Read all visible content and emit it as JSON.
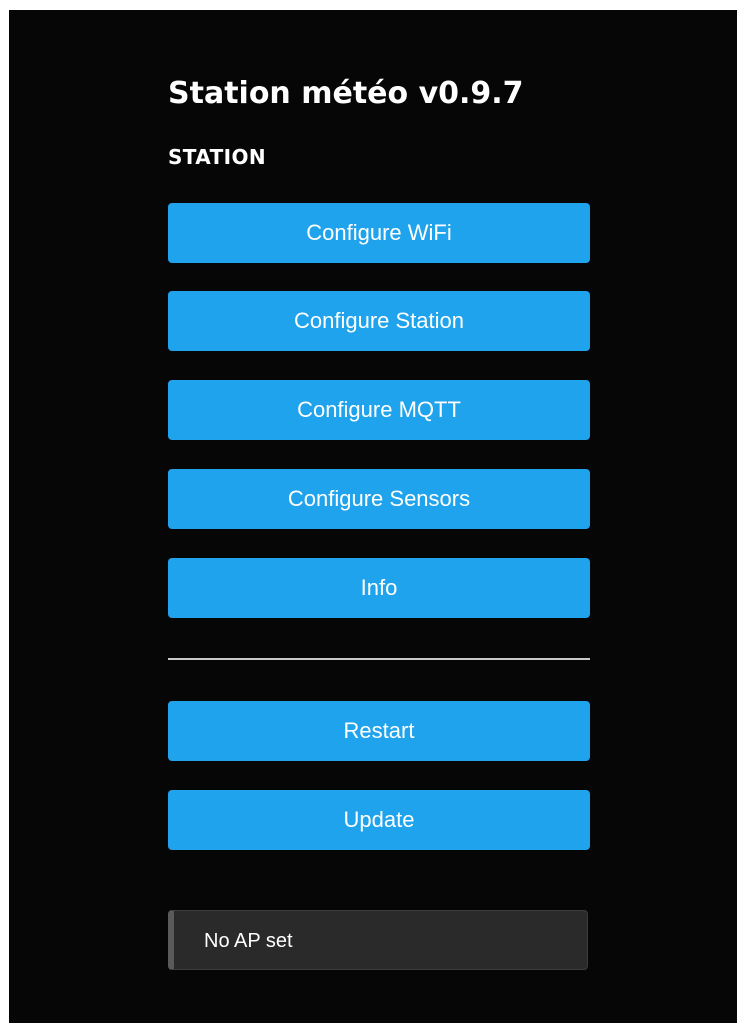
{
  "page": {
    "title": "Station météo v0.9.7",
    "section_label": "STATION"
  },
  "menu": {
    "configure_wifi": "Configure WiFi",
    "configure_station": "Configure Station",
    "configure_mqtt": "Configure MQTT",
    "configure_sensors": "Configure Sensors",
    "info": "Info",
    "restart": "Restart",
    "update": "Update"
  },
  "status": {
    "message": "No AP set"
  },
  "colors": {
    "background": "#060606",
    "button": "#1fa3ec",
    "button_text": "#ffffff",
    "status_box": "#2a2a2a"
  }
}
